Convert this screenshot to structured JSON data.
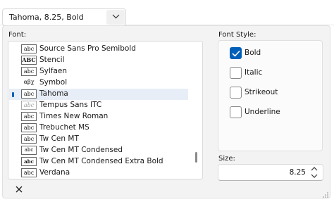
{
  "combo": {
    "value": "Tahoma, 8.25, Bold"
  },
  "labels": {
    "font": "Font:",
    "font_style": "Font Style:",
    "size": "Size:"
  },
  "fonts": [
    {
      "preview": "abc",
      "name": "Source Sans Pro Semibold",
      "selected": false
    },
    {
      "preview": "ABC",
      "name": "Stencil",
      "selected": false
    },
    {
      "preview": "abc",
      "name": "Sylfaen",
      "selected": false
    },
    {
      "preview": "αβχ",
      "name": "Symbol",
      "selected": false
    },
    {
      "preview": "abc",
      "name": "Tahoma",
      "selected": true
    },
    {
      "preview": "abc",
      "name": "Tempus Sans ITC",
      "selected": false
    },
    {
      "preview": "abc",
      "name": "Times New Roman",
      "selected": false
    },
    {
      "preview": "abc",
      "name": "Trebuchet MS",
      "selected": false
    },
    {
      "preview": "abc",
      "name": "Tw Cen MT",
      "selected": false
    },
    {
      "preview": "abc",
      "name": "Tw Cen MT Condensed",
      "selected": false
    },
    {
      "preview": "abc",
      "name": "Tw Cen MT Condensed Extra Bold",
      "selected": false
    },
    {
      "preview": "abc",
      "name": "Verdana",
      "selected": false
    }
  ],
  "styles": [
    {
      "label": "Bold",
      "checked": true
    },
    {
      "label": "Italic",
      "checked": false
    },
    {
      "label": "Strikeout",
      "checked": false
    },
    {
      "label": "Underline",
      "checked": false
    }
  ],
  "size": {
    "value": "8.25"
  },
  "accent": "#005fb8",
  "icons": {
    "dropdown": "chevron-down-icon",
    "close": "close-icon",
    "spin": "spin-updown-icon",
    "grip": "resize-grip-icon"
  }
}
